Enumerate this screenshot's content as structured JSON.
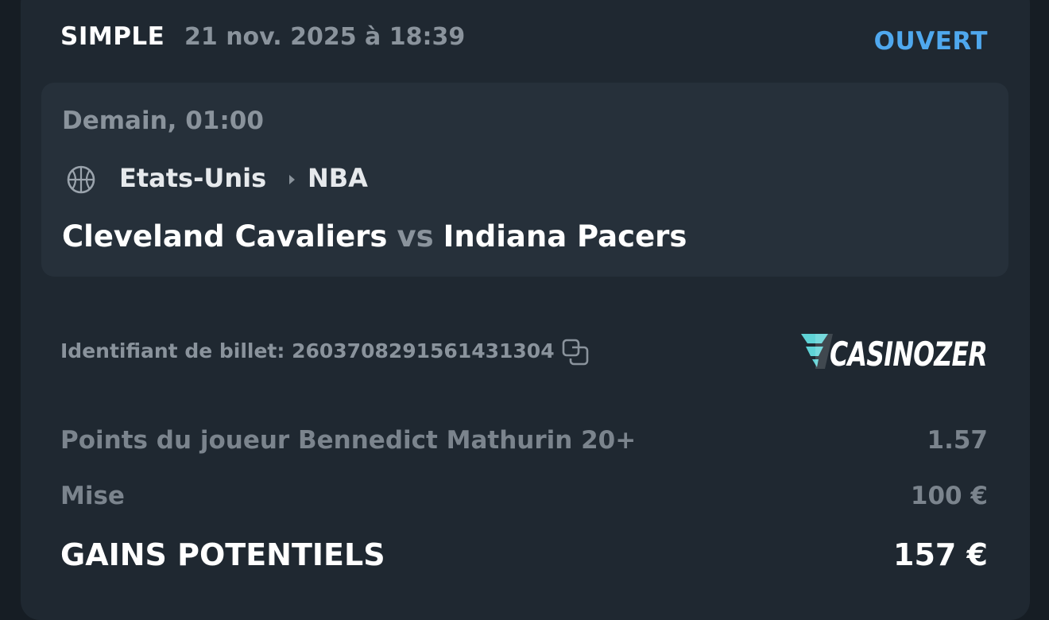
{
  "header": {
    "bet_type": "SIMPLE",
    "placed_at": "21 nov. 2025 à 18:39",
    "status": "OUVERT"
  },
  "event": {
    "start_time": "Demain, 01:00",
    "sport_icon": "basketball-icon",
    "country": "Etats-Unis",
    "league": "NBA",
    "home_team": "Cleveland Cavaliers",
    "vs": "vs",
    "away_team": "Indiana Pacers"
  },
  "ticket": {
    "id_text": "Identifiant de billet: 2603708291561431304",
    "copy_icon": "copy-icon"
  },
  "brand": {
    "name": "CASINOZER"
  },
  "selection": {
    "label": "Points du joueur Bennedict Mathurin 20+",
    "odds": "1.57"
  },
  "stake": {
    "label": "Mise",
    "value": "100 €"
  },
  "payout": {
    "label": "GAINS POTENTIELS",
    "value": "157 €"
  },
  "colors": {
    "background": "#161d24",
    "card": "#1f2831",
    "event_panel": "#26303a",
    "status_accent": "#4fa8ee",
    "muted_text": "#8a939c",
    "logo_accent": "#5fd3d6"
  }
}
